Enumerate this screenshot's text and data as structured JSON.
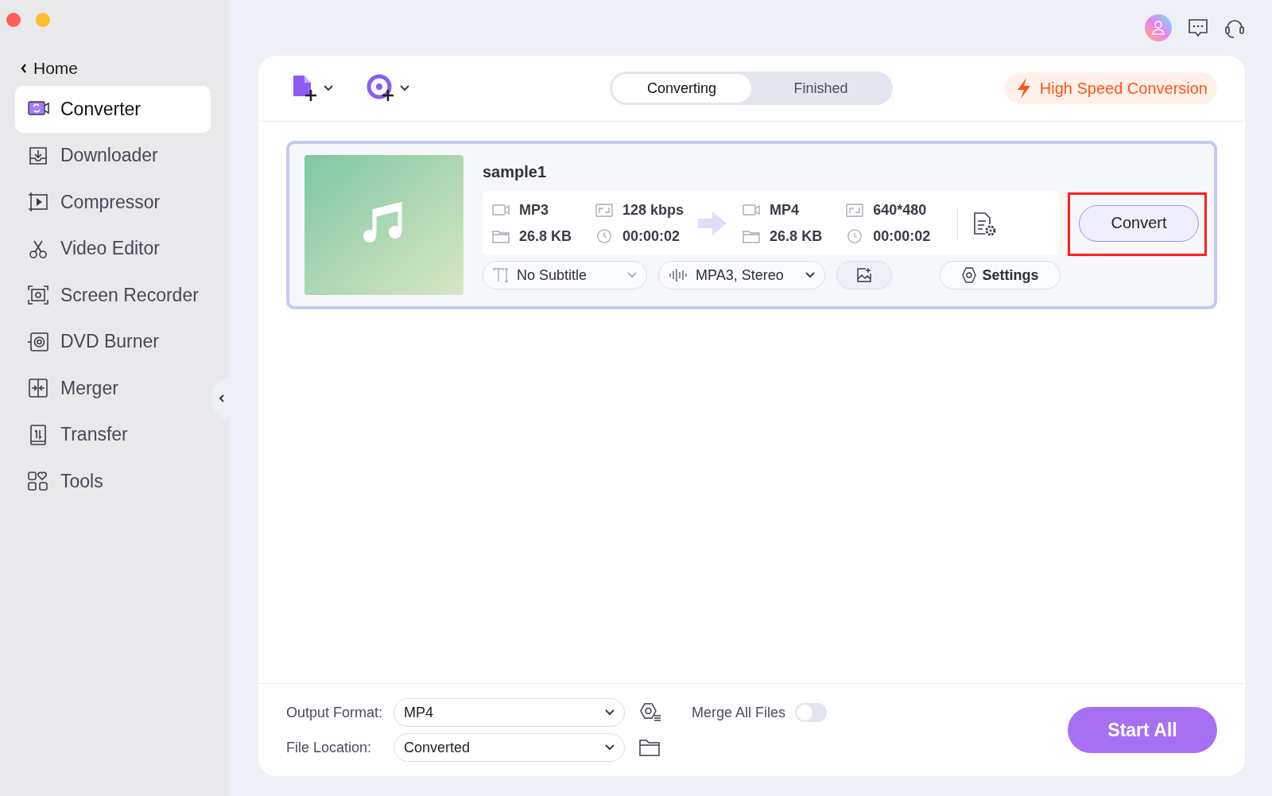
{
  "sidebar": {
    "back": "Home",
    "items": [
      {
        "label": "Converter",
        "selected": true
      },
      {
        "label": "Downloader",
        "selected": false
      },
      {
        "label": "Compressor",
        "selected": false
      },
      {
        "label": "Video Editor",
        "selected": false
      },
      {
        "label": "Screen Recorder",
        "selected": false
      },
      {
        "label": "DVD Burner",
        "selected": false
      },
      {
        "label": "Merger",
        "selected": false
      },
      {
        "label": "Transfer",
        "selected": false
      },
      {
        "label": "Tools",
        "selected": false
      }
    ]
  },
  "toolbar": {
    "tabs": [
      {
        "label": "Converting",
        "selected": true
      },
      {
        "label": "Finished",
        "selected": false
      }
    ],
    "high_speed": "High Speed Conversion"
  },
  "files": [
    {
      "name": "sample1",
      "source": {
        "format": "MP3",
        "bitrate": "128 kbps",
        "size": "26.8 KB",
        "duration": "00:00:02"
      },
      "target": {
        "format": "MP4",
        "resolution": "640*480",
        "size": "26.8 KB",
        "duration": "00:00:02"
      },
      "subtitle": "No Subtitle",
      "audio": "MPA3, Stereo",
      "settings": "Settings",
      "convert": "Convert",
      "highlighted": true
    }
  ],
  "bottom": {
    "output_format_label": "Output Format:",
    "output_format": "MP4",
    "merge_label": "Merge All Files",
    "merge_on": false,
    "file_location_label": "File Location:",
    "file_location": "Converted",
    "start_all": "Start All"
  }
}
